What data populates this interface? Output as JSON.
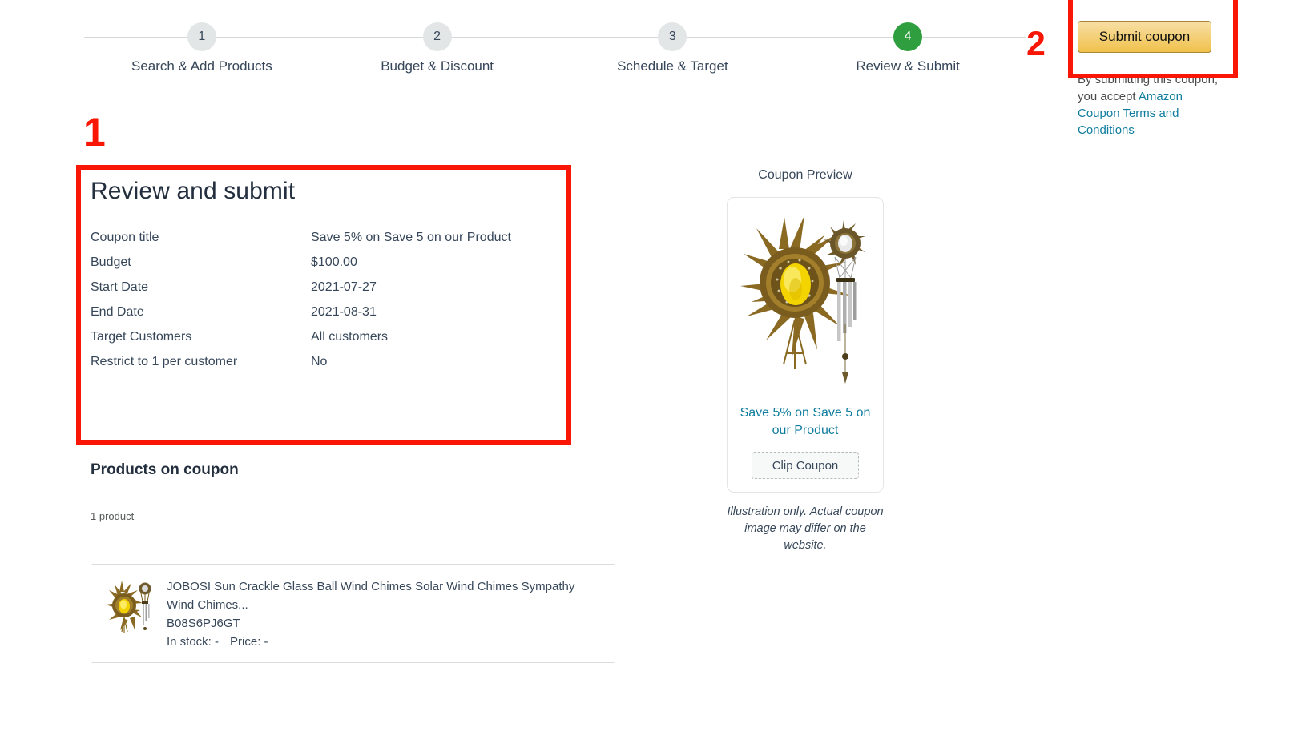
{
  "stepper": {
    "steps": [
      {
        "number": "1",
        "label": "Search & Add Products",
        "state": "inactive"
      },
      {
        "number": "2",
        "label": "Budget & Discount",
        "state": "inactive"
      },
      {
        "number": "3",
        "label": "Schedule & Target",
        "state": "inactive"
      },
      {
        "number": "4",
        "label": "Review & Submit",
        "state": "active"
      }
    ],
    "active_color": "#2e9e3e",
    "inactive_color": "#e3e6e6"
  },
  "submit": {
    "button_label": "Submit coupon",
    "disclaimer_prefix": "By submitting this coupon, you accept ",
    "disclaimer_link": "Amazon Coupon Terms and Conditions",
    "button_color": "#f0c14b",
    "link_color": "#0f7c9e"
  },
  "review": {
    "title": "Review and submit",
    "rows": [
      {
        "label": "Coupon title",
        "value": "Save 5% on Save 5 on our Product"
      },
      {
        "label": "Budget",
        "value": "$100.00"
      },
      {
        "label": "Start Date",
        "value": "2021-07-27"
      },
      {
        "label": "End Date",
        "value": "2021-08-31"
      },
      {
        "label": "Target Customers",
        "value": "All customers"
      },
      {
        "label": "Restrict to 1 per customer",
        "value": "No"
      }
    ]
  },
  "products": {
    "heading": "Products on coupon",
    "count_label": "1 product",
    "items": [
      {
        "title": "JOBOSI Sun Crackle Glass Ball Wind Chimes Solar Wind Chimes Sympathy Wind Chimes...",
        "asin": "B08S6PJ6GT",
        "stock_label": "In stock: -",
        "price_label": "Price: -"
      }
    ]
  },
  "coupon_preview": {
    "title": "Coupon Preview",
    "offer_text": "Save 5% on Save 5 on our Product",
    "clip_button_label": "Clip Coupon",
    "disclaimer": "Illustration only. Actual coupon image may differ on the website."
  },
  "annotations": [
    {
      "number": "1",
      "target": "review-panel"
    },
    {
      "number": "2",
      "target": "submit-coupon-button"
    }
  ]
}
